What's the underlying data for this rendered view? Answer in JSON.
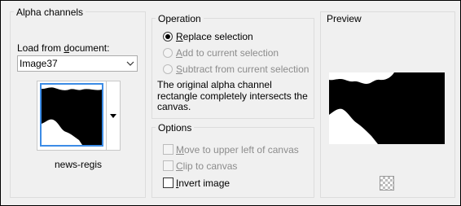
{
  "alpha_channels": {
    "title": "Alpha channels",
    "load_label_prefix": "Load from ",
    "load_label_underlined": "d",
    "load_label_suffix": "ocument:",
    "document_value": "Image37",
    "channel_name": "news-regis"
  },
  "operation": {
    "title": "Operation",
    "options": [
      {
        "u": "R",
        "rest": "eplace selection",
        "selected": true,
        "enabled": true
      },
      {
        "u": "A",
        "rest": "dd to current selection",
        "selected": false,
        "enabled": false
      },
      {
        "u": "S",
        "rest": "ubtract from current selection",
        "selected": false,
        "enabled": false
      }
    ],
    "info_line1": "The original alpha channel",
    "info_line2": "rectangle completely intersects the",
    "info_line3": "canvas."
  },
  "options": {
    "title": "Options",
    "items": [
      {
        "u": "M",
        "rest": "ove to upper left of canvas",
        "checked": false,
        "enabled": false
      },
      {
        "u": "C",
        "rest": "lip to canvas",
        "checked": false,
        "enabled": false
      },
      {
        "u": "I",
        "rest": "nvert image",
        "checked": false,
        "enabled": true
      }
    ]
  },
  "preview": {
    "title": "Preview",
    "transparency_icon": "checkerboard-icon"
  }
}
